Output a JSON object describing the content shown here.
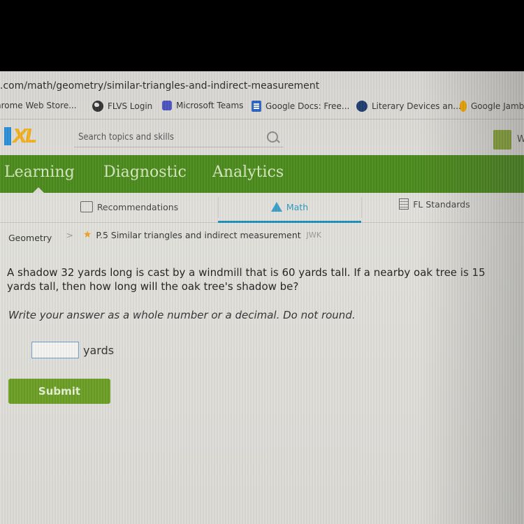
{
  "browser": {
    "url": "l.com/math/geometry/similar-triangles-and-indirect-measurement",
    "bookmarks": [
      {
        "label": "hrome Web Store...",
        "icon": "none"
      },
      {
        "label": "FLVS Login",
        "icon": "globe-icon"
      },
      {
        "label": "Microsoft Teams",
        "icon": "teams-icon"
      },
      {
        "label": "Google Docs: Free...",
        "icon": "docs-icon"
      },
      {
        "label": "Literary Devices an...",
        "icon": "literary-icon"
      },
      {
        "label": "Google Jamboa",
        "icon": "jamboard-icon"
      }
    ]
  },
  "header": {
    "logo": "IXL",
    "search_placeholder": "Search topics and skills",
    "user_initial": "W"
  },
  "nav": {
    "items": [
      "Learning",
      "Diagnostic",
      "Analytics"
    ],
    "active": "Learning",
    "color": "#4b8a1c"
  },
  "subtabs": {
    "items": [
      "Recommendations",
      "Math",
      "FL Standards"
    ],
    "active": "Math"
  },
  "breadcrumb": {
    "subject": "Geometry",
    "skill": "P.5 Similar triangles and indirect measurement",
    "code": "JWK"
  },
  "question": {
    "text": "A shadow 32 yards long is cast by a windmill that is 60 yards tall. If a nearby oak tree is 15 yards tall, then how long will the oak tree's shadow be?",
    "instructions": "Write your answer as a whole number or a decimal. Do not round.",
    "answer_value": "",
    "unit": "yards",
    "submit_label": "Submit"
  }
}
